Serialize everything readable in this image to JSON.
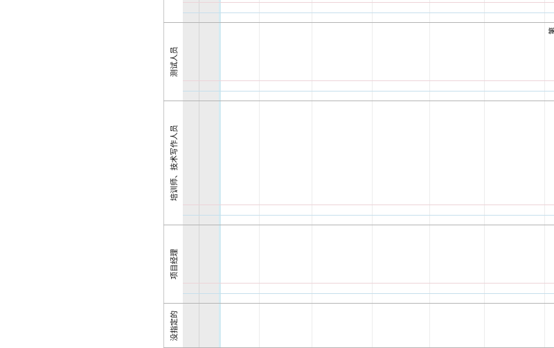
{
  "swimlanes": [
    {
      "id": "top-partial",
      "label": ""
    },
    {
      "id": "testers",
      "label": "测试人员"
    },
    {
      "id": "trainers-tech-writers",
      "label": "培训师、技术写作人员"
    },
    {
      "id": "project-manager",
      "label": "项目经理"
    },
    {
      "id": "unassigned",
      "label": "没指定的"
    }
  ],
  "canvas": {
    "partial_glyph": "第"
  },
  "colors": {
    "lane_separator": "#b4b4b4",
    "gutter": "#ebebeb",
    "grid": "#ececec",
    "guide_red": "#edd3d8",
    "guide_blue": "#c6dfec",
    "gutter_edge": "#d3ebf3"
  }
}
